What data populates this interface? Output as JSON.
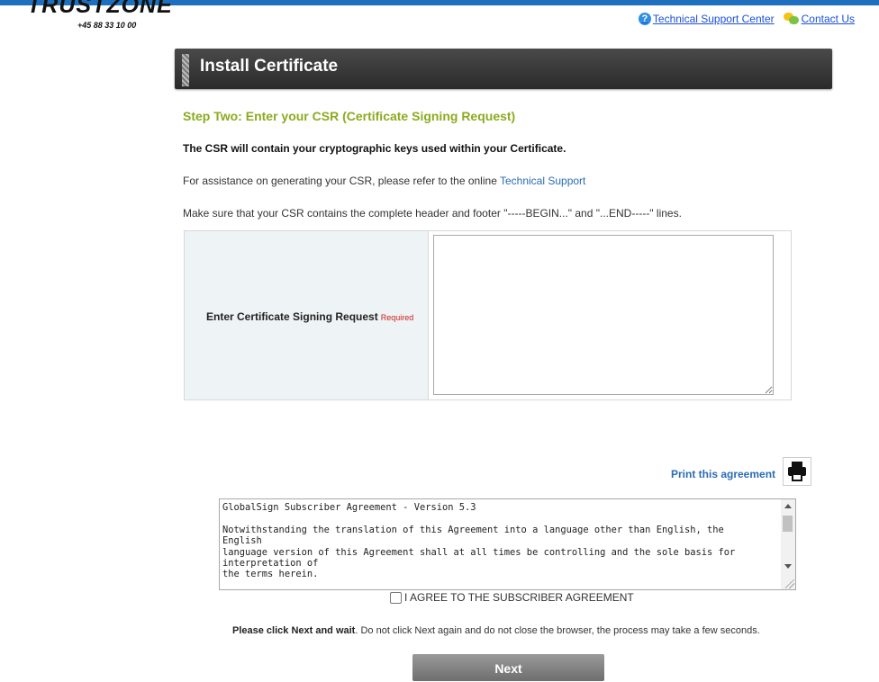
{
  "brand": {
    "logo_text": "TRUSTZONE",
    "phone": "+45 88 33 10 00"
  },
  "top_links": {
    "support": "Technical Support Center",
    "contact": "Contact Us"
  },
  "header": {
    "title": "Install Certificate"
  },
  "content": {
    "step_title": "Step Two: Enter your CSR (Certificate Signing Request)",
    "intro": "The CSR will contain your cryptographic keys used within your Certificate.",
    "assist_prefix": "For assistance on generating your CSR, please refer to the online ",
    "assist_link": "Technical Support",
    "header_footer_note": "Make sure that your CSR contains the complete header and footer \"-----BEGIN...\" and \"...END-----\" lines."
  },
  "csr_form": {
    "label": "Enter Certificate Signing Request",
    "required": "Required",
    "value": ""
  },
  "agreement": {
    "print_label": "Print this agreement",
    "text": "GlobalSign Subscriber Agreement - Version 5.3\n\nNotwithstanding the translation of this Agreement into a language other than English, the\nEnglish\nlanguage version of this Agreement shall at all times be controlling and the sole basis for\ninterpretation of\nthe terms herein.",
    "checkbox_label": "I AGREE TO THE SUBSCRIBER AGREEMENT",
    "checked": false
  },
  "footer": {
    "notice_bold": "Please click Next and wait",
    "notice_rest": ". Do not click Next again and do not close the browser, the process may take a few seconds.",
    "next_label": "Next"
  },
  "colors": {
    "accent_green": "#8bab1e",
    "link_blue": "#2a6cb5",
    "top_bar": "#1f6fbf",
    "required_red": "#cc2222"
  }
}
